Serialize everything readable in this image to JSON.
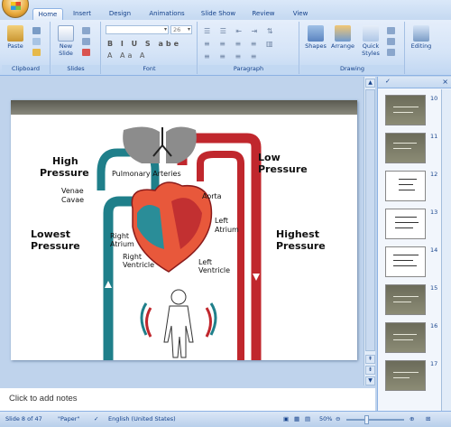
{
  "ribbon": {
    "tabs": [
      "Home",
      "Insert",
      "Design",
      "Animations",
      "Slide Show",
      "Review",
      "View"
    ],
    "groups": {
      "clipboard": {
        "label": "Clipboard",
        "paste": "Paste"
      },
      "slides": {
        "label": "Slides",
        "new_slide": "New Slide"
      },
      "font": {
        "label": "Font",
        "size": "26"
      },
      "paragraph": {
        "label": "Paragraph"
      },
      "drawing": {
        "label": "Drawing",
        "shapes": "Shapes",
        "arrange": "Arrange",
        "quick_styles": "Quick Styles"
      },
      "editing": {
        "label": "Editing"
      }
    }
  },
  "slide": {
    "labels": {
      "high_pressure_1": "High",
      "high_pressure_2": "Pressure",
      "pulmonary": "Pulmonary Arteries",
      "low_pressure_1": "Low",
      "low_pressure_2": "Pressure",
      "venae_1": "Venae",
      "venae_2": "Cavae",
      "aorta": "Aorta",
      "lowest_1": "Lowest",
      "lowest_2": "Pressure",
      "left_atrium_1": "Left",
      "left_atrium_2": "Atrium",
      "highest_1": "Highest",
      "highest_2": "Pressure",
      "right_atrium_1": "Right",
      "right_atrium_2": "Atrium",
      "right_ventricle_1": "Right",
      "right_ventricle_2": "Ventricle",
      "left_ventricle_1": "Left",
      "left_ventricle_2": "Ventricle"
    },
    "colors": {
      "oxygenated": "#c0272d",
      "deoxygenated": "#1f7f8a",
      "lungs": "#8c8c8c"
    }
  },
  "thumbnails": {
    "numbers": [
      "10",
      "11",
      "12",
      "13",
      "14",
      "15",
      "16",
      "17"
    ]
  },
  "notes": {
    "placeholder": "Click to add notes"
  },
  "status": {
    "slide": "Slide 8 of 47",
    "theme": "\"Paper\"",
    "language": "English (United States)",
    "zoom": "50%"
  }
}
